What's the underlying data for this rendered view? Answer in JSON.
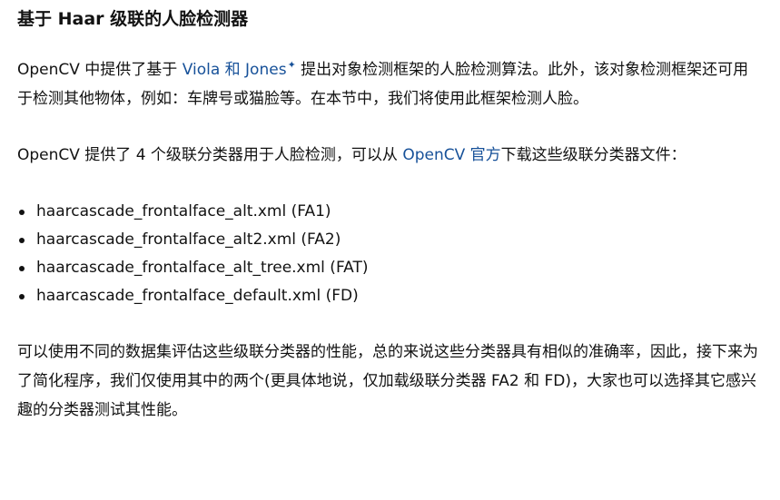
{
  "heading": "基于 Haar 级联的人脸检测器",
  "para1": {
    "prefix": "OpenCV 中提供了基于 ",
    "link": "Viola 和 Jones",
    "suffix": " 提出对象检测框架的人脸检测算法。此外，该对象检测框架还可用于检测其他物体，例如：车牌号或猫脸等。在本节中，我们将使用此框架检测人脸。"
  },
  "para2": {
    "prefix": "OpenCV 提供了 4 个级联分类器用于人脸检测，可以从 ",
    "link": "OpenCV 官方",
    "suffix": "下载这些级联分类器文件："
  },
  "files": [
    "haarcascade_frontalface_alt.xml (FA1)",
    "haarcascade_frontalface_alt2.xml (FA2)",
    "haarcascade_frontalface_alt_tree.xml (FAT)",
    "haarcascade_frontalface_default.xml (FD)"
  ],
  "para3": "可以使用不同的数据集评估这些级联分类器的性能，总的来说这些分类器具有相似的准确率，因此，接下来为了简化程序，我们仅使用其中的两个(更具体地说，仅加载级联分类器 FA2 和 FD)，大家也可以选择其它感兴趣的分类器测试其性能。"
}
